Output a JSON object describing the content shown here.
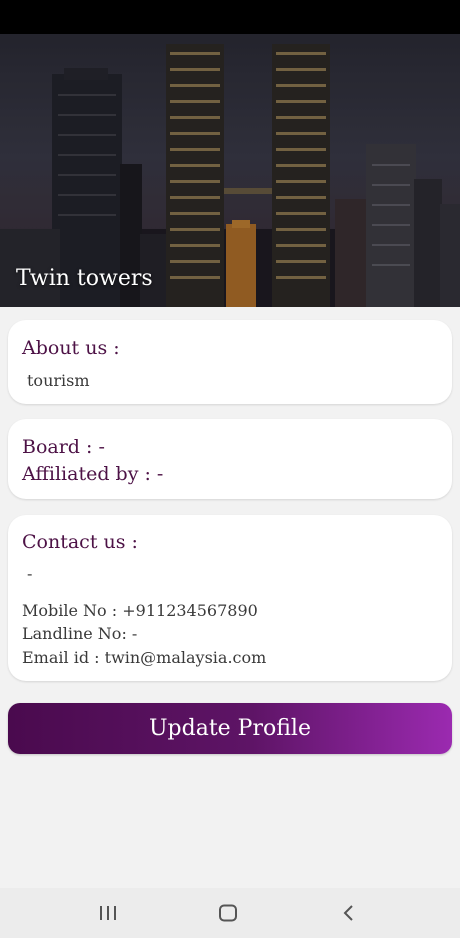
{
  "hero": {
    "title": "Twin towers"
  },
  "about": {
    "heading": "About us :",
    "text": "tourism"
  },
  "board": {
    "board_label": "Board :  -",
    "affiliated_label": "Affiliated by :  -"
  },
  "contact": {
    "heading": "Contact us :",
    "address": "-",
    "mobile": "Mobile No : +911234567890",
    "landline": "Landline No:  -",
    "email": "Email id : twin@malaysia.com"
  },
  "actions": {
    "update_label": "Update Profile"
  },
  "nav": {
    "recents_icon": "recents-icon",
    "home_icon": "home-icon",
    "back_icon": "back-icon"
  },
  "colors": {
    "heading": "#4d1246",
    "button_start": "#4a0a4e",
    "button_end": "#9b2ab0"
  }
}
